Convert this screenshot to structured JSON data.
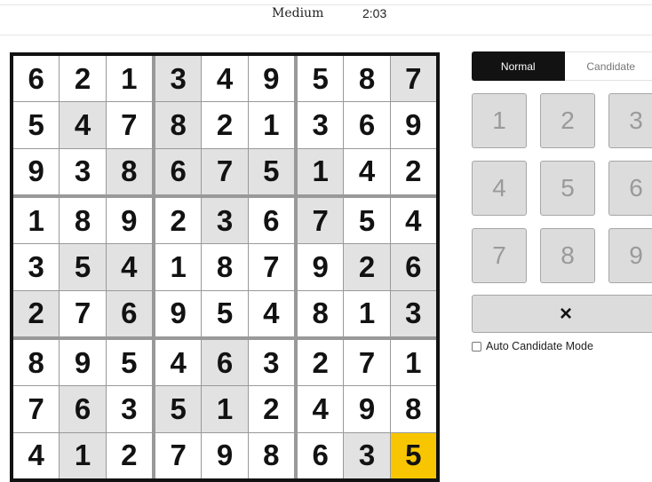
{
  "header": {
    "difficulty": "Medium",
    "timer": "2:03"
  },
  "board": {
    "rows": [
      [
        6,
        2,
        1,
        3,
        4,
        9,
        5,
        8,
        7
      ],
      [
        5,
        4,
        7,
        8,
        2,
        1,
        3,
        6,
        9
      ],
      [
        9,
        3,
        8,
        6,
        7,
        5,
        1,
        4,
        2
      ],
      [
        1,
        8,
        9,
        2,
        3,
        6,
        7,
        5,
        4
      ],
      [
        3,
        5,
        4,
        1,
        8,
        7,
        9,
        2,
        6
      ],
      [
        2,
        7,
        6,
        9,
        5,
        4,
        8,
        1,
        3
      ],
      [
        8,
        9,
        5,
        4,
        6,
        3,
        2,
        7,
        1
      ],
      [
        7,
        6,
        3,
        5,
        1,
        2,
        4,
        9,
        8
      ],
      [
        4,
        1,
        2,
        7,
        9,
        8,
        6,
        3,
        5
      ]
    ],
    "highlighted": [
      [
        0,
        3
      ],
      [
        0,
        8
      ],
      [
        1,
        1
      ],
      [
        1,
        3
      ],
      [
        2,
        2
      ],
      [
        2,
        3
      ],
      [
        2,
        4
      ],
      [
        2,
        5
      ],
      [
        2,
        6
      ],
      [
        3,
        4
      ],
      [
        3,
        6
      ],
      [
        4,
        1
      ],
      [
        4,
        2
      ],
      [
        4,
        7
      ],
      [
        4,
        8
      ],
      [
        5,
        0
      ],
      [
        5,
        2
      ],
      [
        5,
        8
      ],
      [
        6,
        4
      ],
      [
        7,
        1
      ],
      [
        7,
        3
      ],
      [
        7,
        4
      ],
      [
        8,
        1
      ],
      [
        8,
        7
      ]
    ],
    "selected": [
      8,
      8
    ],
    "selected_color": "#f8c600",
    "highlight_color": "#e2e2e2"
  },
  "mode_toggle": {
    "normal_label": "Normal",
    "candidate_label": "Candidate",
    "active": "normal"
  },
  "keypad": {
    "keys": [
      "1",
      "2",
      "3",
      "4",
      "5",
      "6",
      "7",
      "8",
      "9"
    ],
    "erase_icon": "×"
  },
  "auto_candidate": {
    "label": "Auto Candidate Mode",
    "checked": false
  }
}
